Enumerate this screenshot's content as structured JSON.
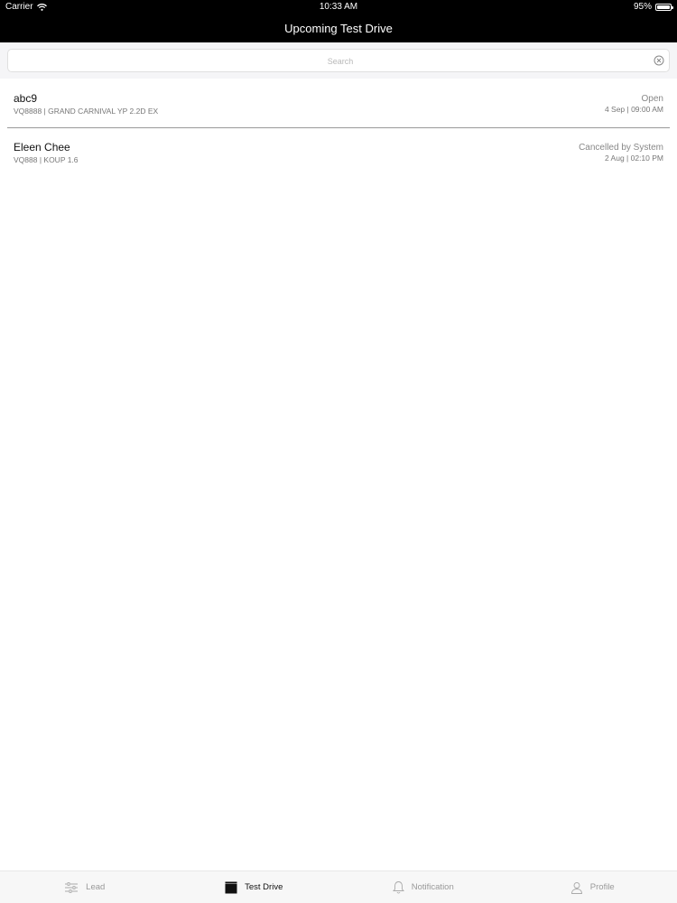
{
  "status_bar": {
    "carrier": "Carrier",
    "time": "10:33 AM",
    "battery": "95%",
    "wifi_icon": "wifi-icon",
    "battery_icon": "battery-icon"
  },
  "nav": {
    "title": "Upcoming Test Drive"
  },
  "search": {
    "placeholder": "Search",
    "clear_icon": "clear-icon"
  },
  "list": {
    "items": [
      {
        "name": "abc9",
        "sub": "VQ8888 | GRAND CARNIVAL YP 2.2D EX",
        "status": "Open",
        "date": "4 Sep | 09:00 AM"
      },
      {
        "name": "Eleen Chee",
        "sub": "VQ888 | KOUP 1.6",
        "status": "Cancelled by System",
        "date": "2 Aug | 02:10 PM"
      }
    ]
  },
  "tabs": [
    {
      "label": "Lead",
      "icon": "sliders-icon",
      "active": false
    },
    {
      "label": "Test Drive",
      "icon": "clapperboard-icon",
      "active": true
    },
    {
      "label": "Notification",
      "icon": "bell-icon",
      "active": false
    },
    {
      "label": "Profile",
      "icon": "person-icon",
      "active": false
    }
  ],
  "colors": {
    "header_bg": "#000000",
    "tab_active": "#111111",
    "tab_inactive": "#999999"
  }
}
